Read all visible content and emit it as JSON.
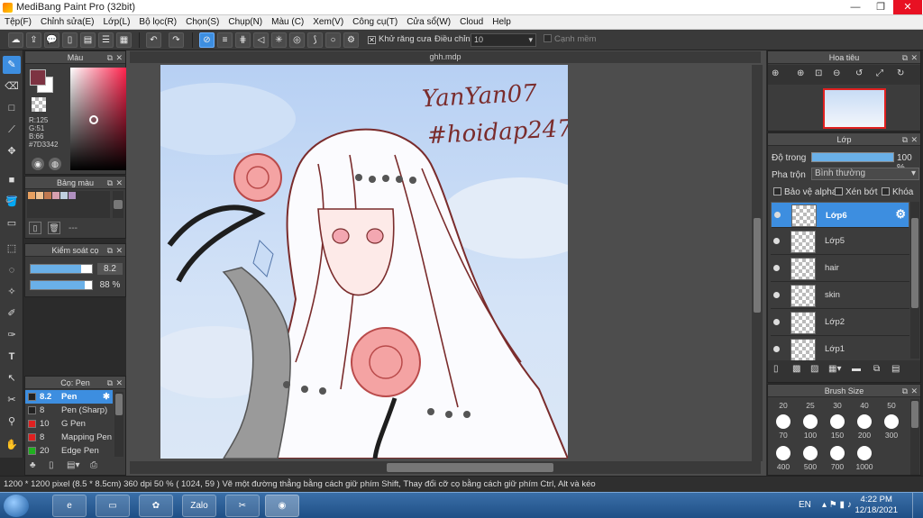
{
  "window": {
    "title": "MediBang Paint Pro (32bit)"
  },
  "menu": [
    "Tệp(F)",
    "Chỉnh sửa(E)",
    "Lớp(L)",
    "Bộ lọc(R)",
    "Chọn(S)",
    "Chụp(N)",
    "Màu (C)",
    "Xem(V)",
    "Công cụ(T)",
    "Cửa sổ(W)",
    "Cloud",
    "Help"
  ],
  "toolbar": {
    "antialias_label": "Khử răng cưa",
    "adjust_label": "Điều chỉnh",
    "adjust_value": "10",
    "smooth_label": "Cạnh mềm"
  },
  "color_panel": {
    "title": "Màu",
    "rgb": [
      "R:125",
      "G:51",
      "B:66"
    ],
    "hex": "#7D3342",
    "current_color": "#7D3342"
  },
  "palette_panel": {
    "title": "Bảng màu",
    "dashes": "---",
    "swatches": [
      "#e8a060",
      "#f0c090",
      "#c07850",
      "#d8a0b0",
      "#c0d0e0",
      "#b090c0"
    ]
  },
  "brush_control": {
    "title": "Kiểm soát cọ",
    "size": "8.2",
    "opacity": "88 %",
    "size_fill": 0.82,
    "opacity_fill": 0.88
  },
  "brush_panel": {
    "title": "Cọ: Pen",
    "items": [
      {
        "size": "8.2",
        "name": "Pen",
        "color": "#222222"
      },
      {
        "size": "8",
        "name": "Pen (Sharp)",
        "color": "#222222"
      },
      {
        "size": "10",
        "name": "G Pen",
        "color": "#e02020"
      },
      {
        "size": "8",
        "name": "Mapping Pen",
        "color": "#e02020"
      },
      {
        "size": "20",
        "name": "Edge Pen",
        "color": "#20b020"
      }
    ]
  },
  "document": {
    "tab": "ghh.mdp",
    "watermark_line1": "YanYan07",
    "watermark_line2": "#hoidap247"
  },
  "navigator": {
    "title": "Hoa tiêu"
  },
  "layers_panel": {
    "title": "Lớp",
    "opacity_label": "Độ trong",
    "opacity_value": "100 %",
    "blend_label": "Pha trộn",
    "blend_value": "Bình thường",
    "protect_alpha": "Bảo vệ alpha",
    "clipping": "Xén bớt",
    "lock": "Khóa",
    "layers": [
      "Lớp6",
      "Lớp5",
      "hair",
      "skin",
      "Lớp2",
      "Lớp1"
    ]
  },
  "brush_size_panel": {
    "title": "Brush Size",
    "top_row": [
      "20",
      "25",
      "30",
      "40",
      "50"
    ],
    "row1": [
      "70",
      "100",
      "150",
      "200",
      "300"
    ],
    "row2": [
      "400",
      "500",
      "700",
      "1000"
    ]
  },
  "status": {
    "size": "1200 * 1200 pixel",
    "cm": "(8.5 * 8.5cm)",
    "dpi": "360 dpi",
    "zoom": "50 %",
    "coords": "( 1024, 59 )",
    "hint": "Vẽ một đường thẳng bằng cách giữ phím Shift, Thay đổi cỡ cọ bằng cách giữ phím Ctrl, Alt và kéo"
  },
  "taskbar": {
    "lang": "EN",
    "time": "4:22 PM",
    "date": "12/18/2021",
    "zalo": "Zalo"
  }
}
